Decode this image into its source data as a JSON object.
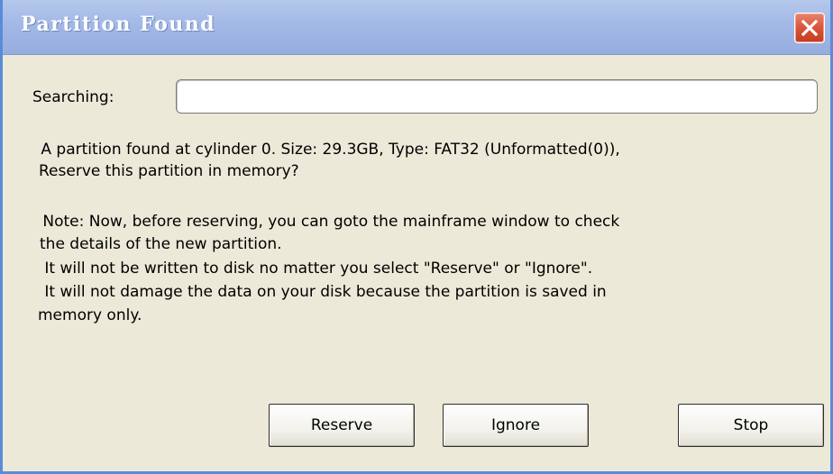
{
  "window": {
    "title": "Partition Found"
  },
  "search": {
    "label": "Searching:",
    "value": ""
  },
  "message": {
    "line1": " A partition found at cylinder 0. Size: 29.3GB, Type: FAT32 (Unformatted(0)),",
    "line2": "Reserve this partition in memory?",
    "note1": " Note: Now, before reserving, you can goto the mainframe window to check",
    "note2": "the details of the new partition.",
    "note3": " It will not be written to disk no matter you select \"Reserve\" or \"Ignore\".",
    "note4": " It will not damage the data on your disk because the partition is saved in",
    "note5": "memory only."
  },
  "buttons": {
    "reserve": "Reserve",
    "ignore": "Ignore",
    "stop": "Stop"
  },
  "icons": {
    "close": "close-icon"
  },
  "colors": {
    "titlebar": "#a2b8e6",
    "background": "#ece9d8",
    "close_button": "#d8543a"
  }
}
